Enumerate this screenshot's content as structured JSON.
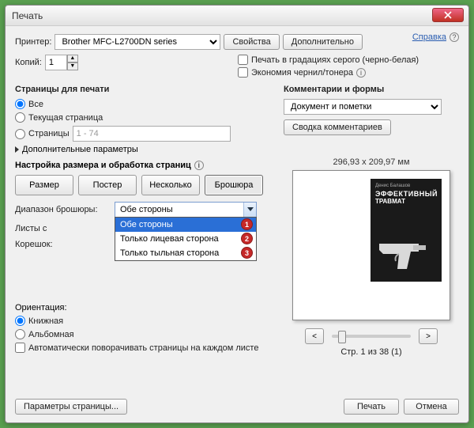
{
  "window": {
    "title": "Печать"
  },
  "help_link": "Справка",
  "printer": {
    "label": "Принтер:",
    "selected": "Brother MFC-L2700DN series",
    "properties_btn": "Свойства",
    "advanced_btn": "Дополнительно"
  },
  "copies": {
    "label": "Копий:",
    "value": "1"
  },
  "options": {
    "grayscale": "Печать в градациях серого (черно-белая)",
    "ink_save": "Экономия чернил/тонера"
  },
  "pages_group": {
    "title": "Страницы для печати",
    "all": "Все",
    "current": "Текущая страница",
    "range_label": "Страницы",
    "range_value": "1 - 74",
    "more": "Дополнительные параметры"
  },
  "comments_group": {
    "title": "Комментарии и формы",
    "selected": "Документ и пометки",
    "summary_btn": "Сводка комментариев"
  },
  "sizing": {
    "title": "Настройка размера и обработка страниц",
    "tabs": {
      "size": "Размер",
      "poster": "Постер",
      "multiple": "Несколько",
      "booklet": "Брошюра"
    },
    "booklet_range_label": "Диапазон брошюры:",
    "booklet_range_value": "Обе стороны",
    "dropdown": [
      "Обе стороны",
      "Только лицевая сторона",
      "Только тыльная сторона"
    ],
    "sheets_label": "Листы с",
    "spine_label": "Корешок:"
  },
  "orientation": {
    "title": "Ориентация:",
    "portrait": "Книжная",
    "landscape": "Альбомная",
    "auto_rotate": "Автоматически поворачивать страницы на каждом листе"
  },
  "preview": {
    "dimensions": "296,93 x 209,97 мм",
    "cover_author": "Денис Балашов",
    "cover_title1": "ЭФФЕКТИВНЫЙ",
    "cover_title2": "ТРАВМАТ",
    "page_status": "Стр. 1 из 38 (1)"
  },
  "bottom": {
    "page_setup": "Параметры страницы...",
    "print": "Печать",
    "cancel": "Отмена"
  }
}
